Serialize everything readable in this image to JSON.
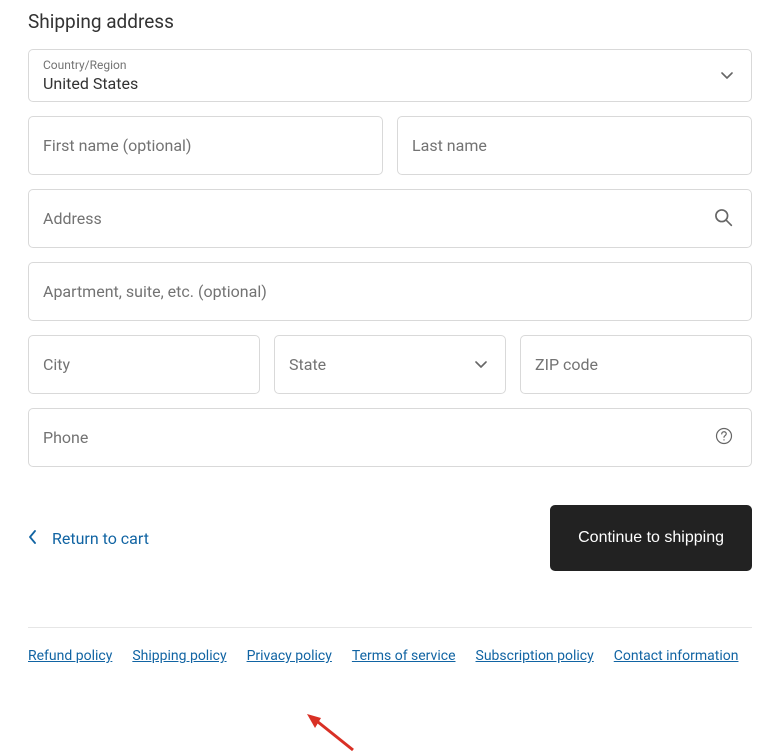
{
  "heading": "Shipping address",
  "country": {
    "label": "Country/Region",
    "value": "United States"
  },
  "fields": {
    "first_name_placeholder": "First name (optional)",
    "last_name_placeholder": "Last name",
    "address_placeholder": "Address",
    "apartment_placeholder": "Apartment, suite, etc. (optional)",
    "city_placeholder": "City",
    "state_placeholder": "State",
    "zip_placeholder": "ZIP code",
    "phone_placeholder": "Phone"
  },
  "actions": {
    "return_label": "Return to cart",
    "continue_label": "Continue to shipping"
  },
  "footer": {
    "refund": "Refund policy",
    "shipping": "Shipping policy",
    "privacy": "Privacy policy",
    "terms": "Terms of service",
    "subscription": "Subscription policy",
    "contact": "Contact information"
  }
}
